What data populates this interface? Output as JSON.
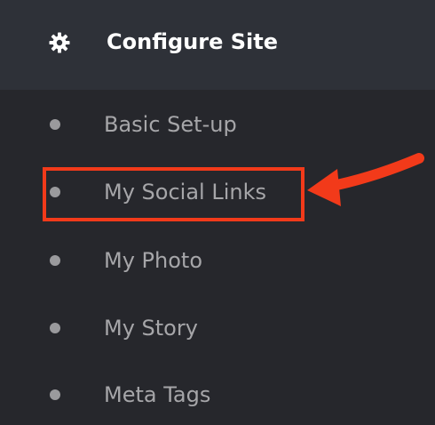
{
  "header": {
    "title": "Configure Site",
    "icon": "gear-icon"
  },
  "menu": {
    "items": [
      {
        "label": "Basic Set-up"
      },
      {
        "label": "My Social Links",
        "highlighted": true
      },
      {
        "label": "My Photo"
      },
      {
        "label": "My Story"
      },
      {
        "label": "Meta Tags"
      }
    ]
  },
  "colors": {
    "header_bg": "#2e3138",
    "panel_bg": "#26272c",
    "highlight": "#f23a1a",
    "text": "#a6a6a9",
    "title": "#ffffff"
  }
}
